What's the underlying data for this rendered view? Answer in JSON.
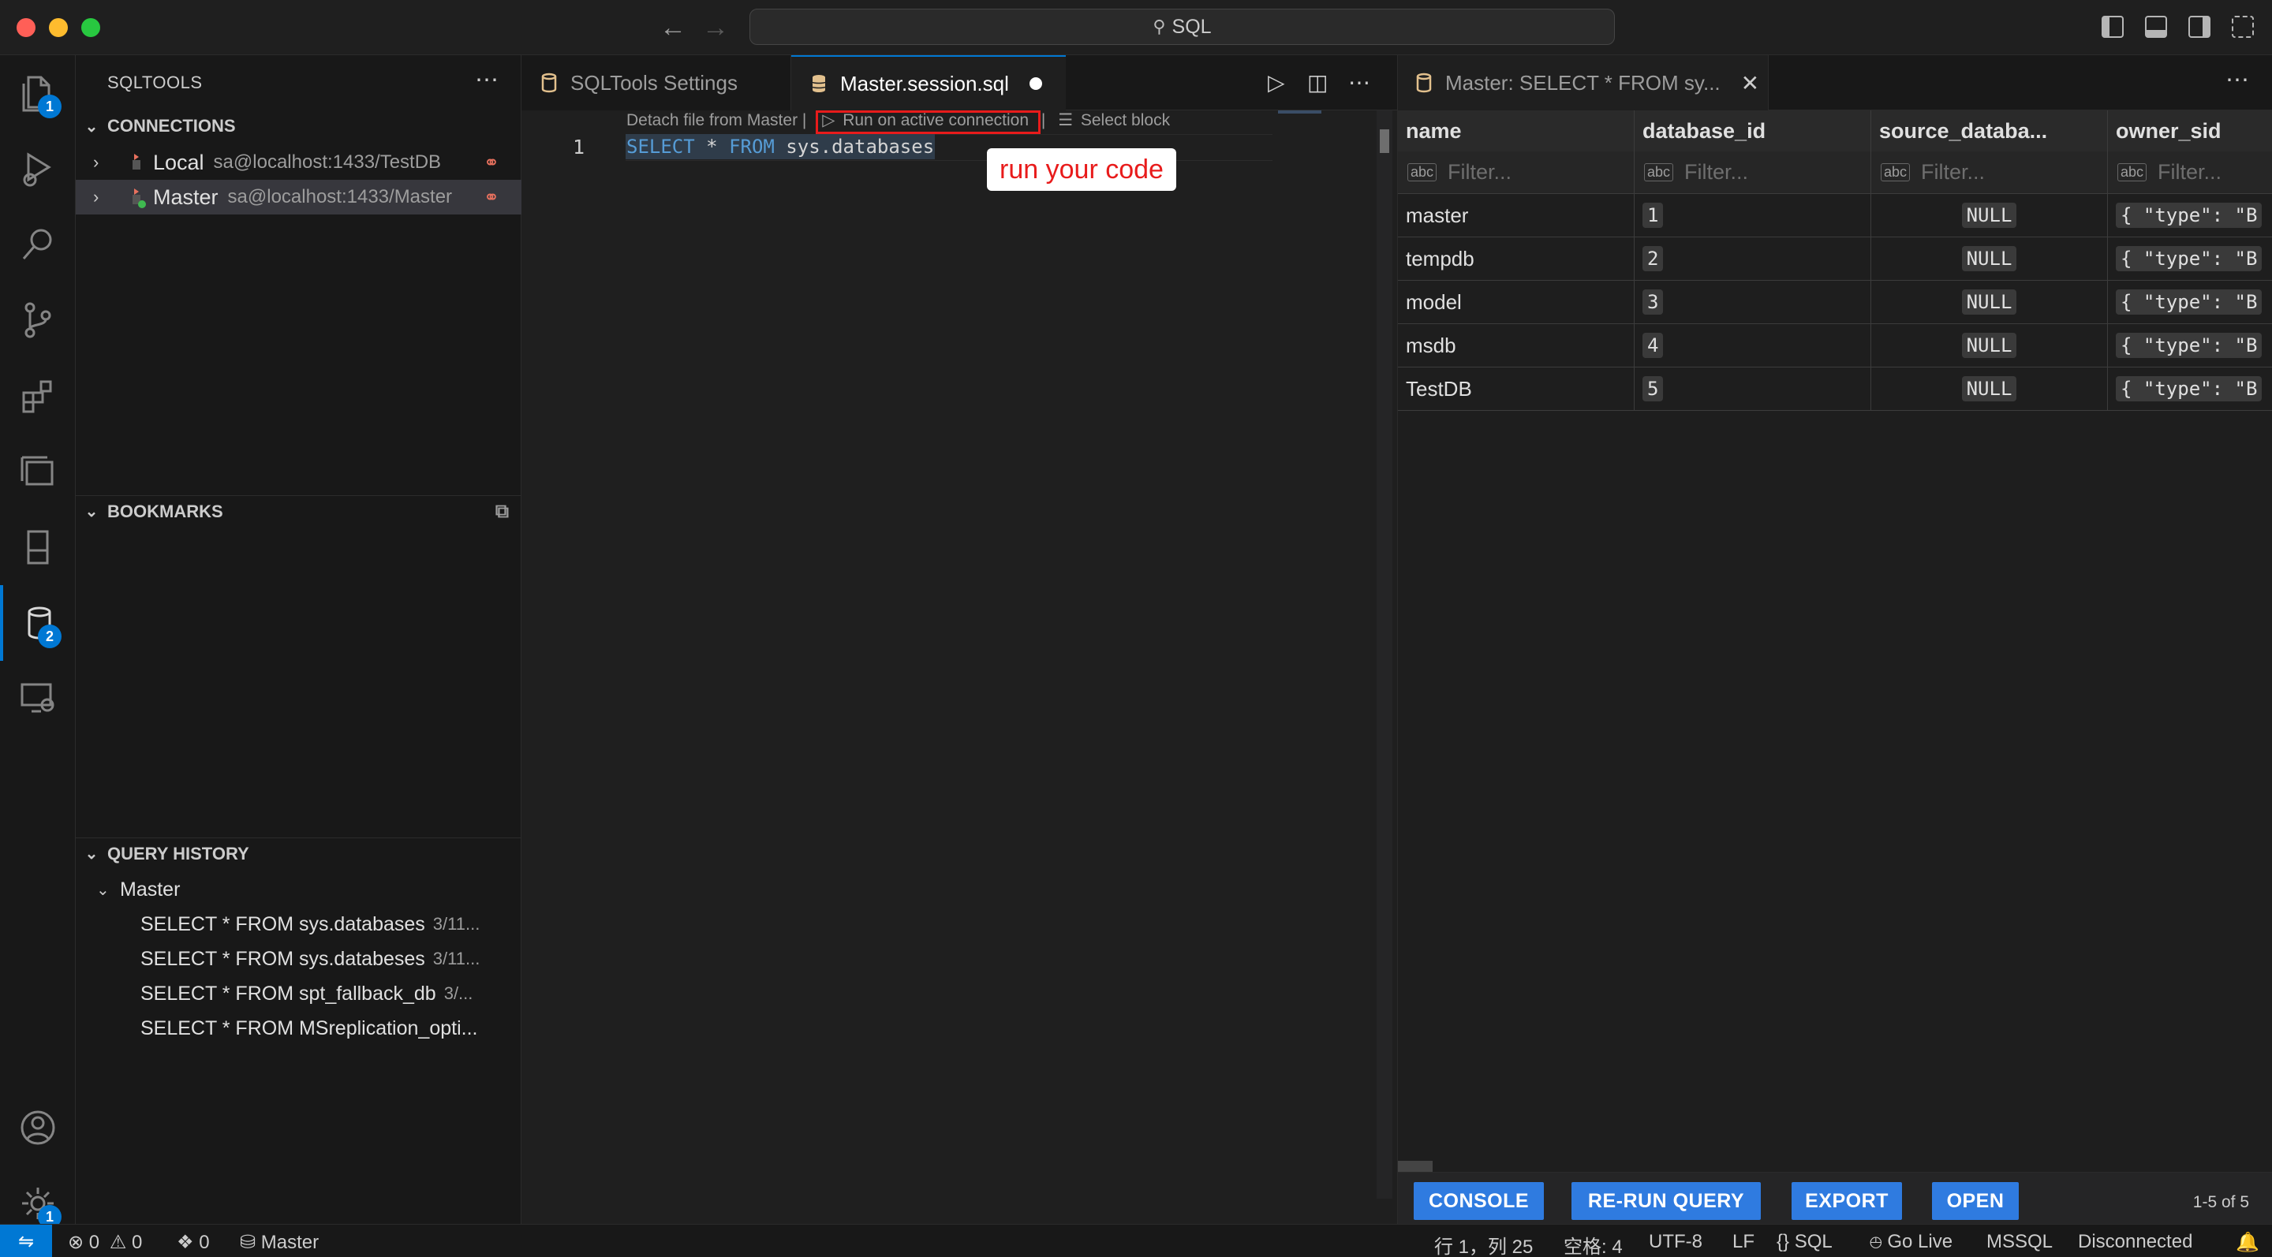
{
  "window": {
    "search_text": "SQL"
  },
  "activity_bar": {
    "explorer_badge": "1",
    "sqltools_badge": "2",
    "settings_badge": "1"
  },
  "sidebar": {
    "title": "SQLTOOLS",
    "connections_title": "CONNECTIONS",
    "connections": [
      {
        "name": "Local",
        "detail": "sa@localhost:1433/TestDB"
      },
      {
        "name": "Master",
        "detail": "sa@localhost:1433/Master"
      }
    ],
    "bookmarks_title": "BOOKMARKS",
    "history_title": "QUERY HISTORY",
    "history_group": "Master",
    "history": [
      {
        "query": "SELECT * FROM sys.databases",
        "date": "3/11..."
      },
      {
        "query": "SELECT * FROM sys.databeses",
        "date": "3/11..."
      },
      {
        "query": "SELECT * FROM spt_fallback_db",
        "date": "3/..."
      },
      {
        "query": "SELECT * FROM MSreplication_opti...",
        "date": ""
      }
    ]
  },
  "editor": {
    "tabs": [
      {
        "label": "SQLTools Settings"
      },
      {
        "label": "Master.session.sql"
      }
    ],
    "codelens": {
      "detach": "Detach file from Master |",
      "run": "Run on active connection",
      "sep": "|",
      "select_block": "Select block"
    },
    "line_number": "1",
    "code": {
      "kw1": "SELECT",
      "star": " * ",
      "kw2": "FROM",
      "rest": " sys.databases"
    },
    "annotation": "run your code"
  },
  "results": {
    "tab_label": "Master: SELECT * FROM sy...",
    "columns": [
      "name",
      "database_id",
      "source_databa...",
      "owner_sid"
    ],
    "filter_placeholder": "Filter...",
    "rows": [
      {
        "name": "master",
        "id": "1",
        "source": "NULL",
        "owner": "{ \"type\": \"B"
      },
      {
        "name": "tempdb",
        "id": "2",
        "source": "NULL",
        "owner": "{ \"type\": \"B"
      },
      {
        "name": "model",
        "id": "3",
        "source": "NULL",
        "owner": "{ \"type\": \"B"
      },
      {
        "name": "msdb",
        "id": "4",
        "source": "NULL",
        "owner": "{ \"type\": \"B"
      },
      {
        "name": "TestDB",
        "id": "5",
        "source": "NULL",
        "owner": "{ \"type\": \"B"
      }
    ],
    "buttons": {
      "console": "CONSOLE",
      "rerun": "RE-RUN QUERY",
      "export": "EXPORT",
      "open": "OPEN"
    },
    "count": "1-5 of 5"
  },
  "statusbar": {
    "errors": "0",
    "warnings": "0",
    "ports": "0",
    "connection": "Master",
    "position": "行 1，列 25",
    "spaces": "空格: 4",
    "encoding": "UTF-8",
    "eol": "LF",
    "language": "SQL",
    "golive": "Go Live",
    "dialect": "MSSQL",
    "status": "Disconnected"
  }
}
